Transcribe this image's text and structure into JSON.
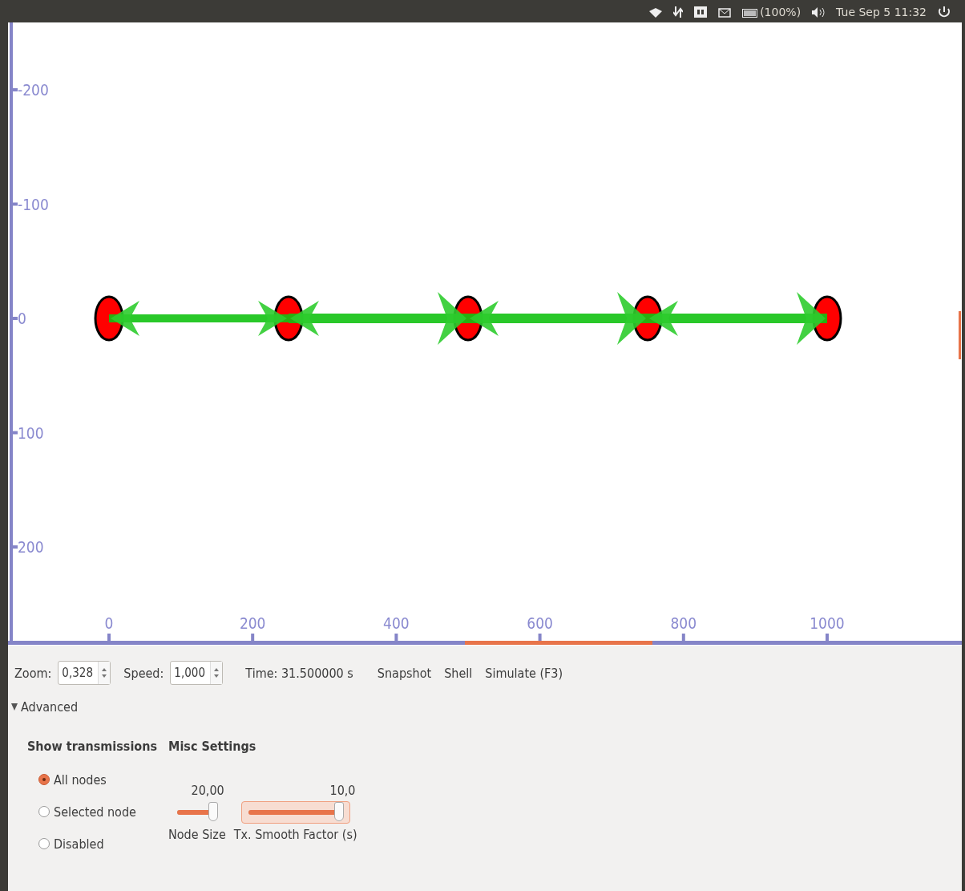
{
  "top_bar": {
    "battery": "(100%)",
    "clock": "Tue Sep 5 11:32"
  },
  "canvas": {
    "y_axis_labels": [
      "-200",
      "-100",
      "0",
      "100",
      "200"
    ],
    "x_axis_labels": [
      "0",
      "200",
      "400",
      "600",
      "800",
      "1000"
    ],
    "links": [
      {
        "kind": "bidirectional"
      },
      {
        "kind": "bidirectional"
      },
      {
        "kind": "bidirectional"
      },
      {
        "kind": "bidirectional"
      }
    ]
  },
  "controls": {
    "zoom": {
      "label": "Zoom:",
      "value": "0,328"
    },
    "speed": {
      "label": "Speed:",
      "value": "1,000"
    },
    "time": "Time: 31.500000 s",
    "buttons": [
      "Snapshot",
      "Shell",
      "Simulate (F3)"
    ]
  },
  "advanced": {
    "label": "Advanced",
    "expanded": true,
    "show_transmissions": {
      "title": "Show transmissions",
      "options": [
        {
          "label": "All nodes",
          "selected": true
        },
        {
          "label": "Selected node",
          "selected": false
        },
        {
          "label": "Disabled",
          "selected": false
        }
      ]
    },
    "misc_settings": {
      "title": "Misc Settings",
      "sliders": [
        {
          "label": "Node Size",
          "reading": "20,00",
          "level": 0.9,
          "focused": false
        },
        {
          "label": "Tx. Smooth Factor (s)",
          "reading": "10,0",
          "level": 0.96,
          "focused": true
        }
      ]
    }
  }
}
